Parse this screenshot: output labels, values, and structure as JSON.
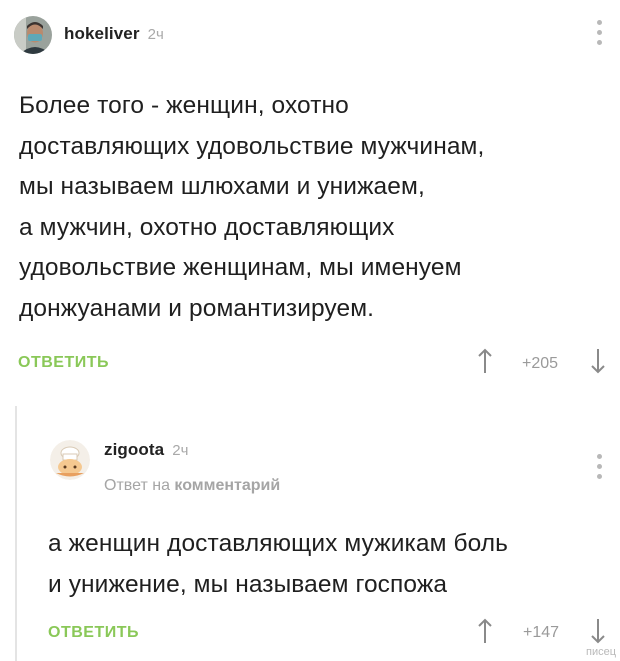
{
  "colors": {
    "accent_green": "#8ac858",
    "muted": "#a5a5a5"
  },
  "comments": [
    {
      "username": "hokeliver",
      "time": "2ч",
      "avatar_icon": "user-photo-avatar",
      "text_lines": [
        "Более того - женщин, охотно",
        "доставляющих удовольствие мужчинам,",
        "мы называем шлюхами и унижаем,",
        "а мужчин, охотно доставляющих",
        "удовольствие женщинам, мы именуем",
        "донжуанами и романтизируем."
      ],
      "reply_label": "ОТВЕТИТЬ",
      "rating": "+205"
    },
    {
      "username": "zigoota",
      "time": "2ч",
      "avatar_icon": "cartoon-avatar",
      "reply_to_prefix": "Ответ на",
      "reply_to_link": "комментарий",
      "text_lines": [
        "а женщин доставляющих мужикам боль",
        "и унижение, мы называем госпожа"
      ],
      "reply_label": "ОТВЕТИТЬ",
      "rating": "+147"
    }
  ],
  "watermark": "писец"
}
